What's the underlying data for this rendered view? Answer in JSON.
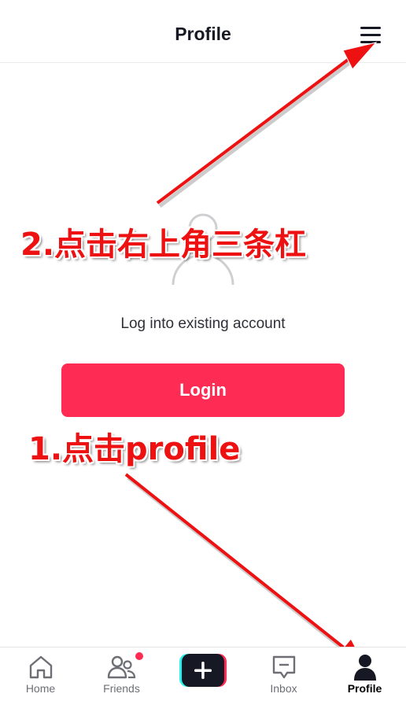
{
  "header": {
    "title": "Profile"
  },
  "main": {
    "subtitle": "Log into existing account",
    "login_label": "Login"
  },
  "annotations": {
    "step2": "2.点击右上角三条杠",
    "step1": "1.点击profile"
  },
  "tabbar": {
    "tabs": [
      {
        "label": "Home",
        "icon": "home-icon"
      },
      {
        "label": "Friends",
        "icon": "friends-icon"
      },
      {
        "label": "",
        "icon": "plus-icon"
      },
      {
        "label": "Inbox",
        "icon": "inbox-icon"
      },
      {
        "label": "Profile",
        "icon": "profile-icon"
      }
    ]
  },
  "colors": {
    "accent": "#fe2c55",
    "annotation": "#ee1111",
    "plus_left": "#25f4ee",
    "plus_right": "#fe2c55"
  }
}
